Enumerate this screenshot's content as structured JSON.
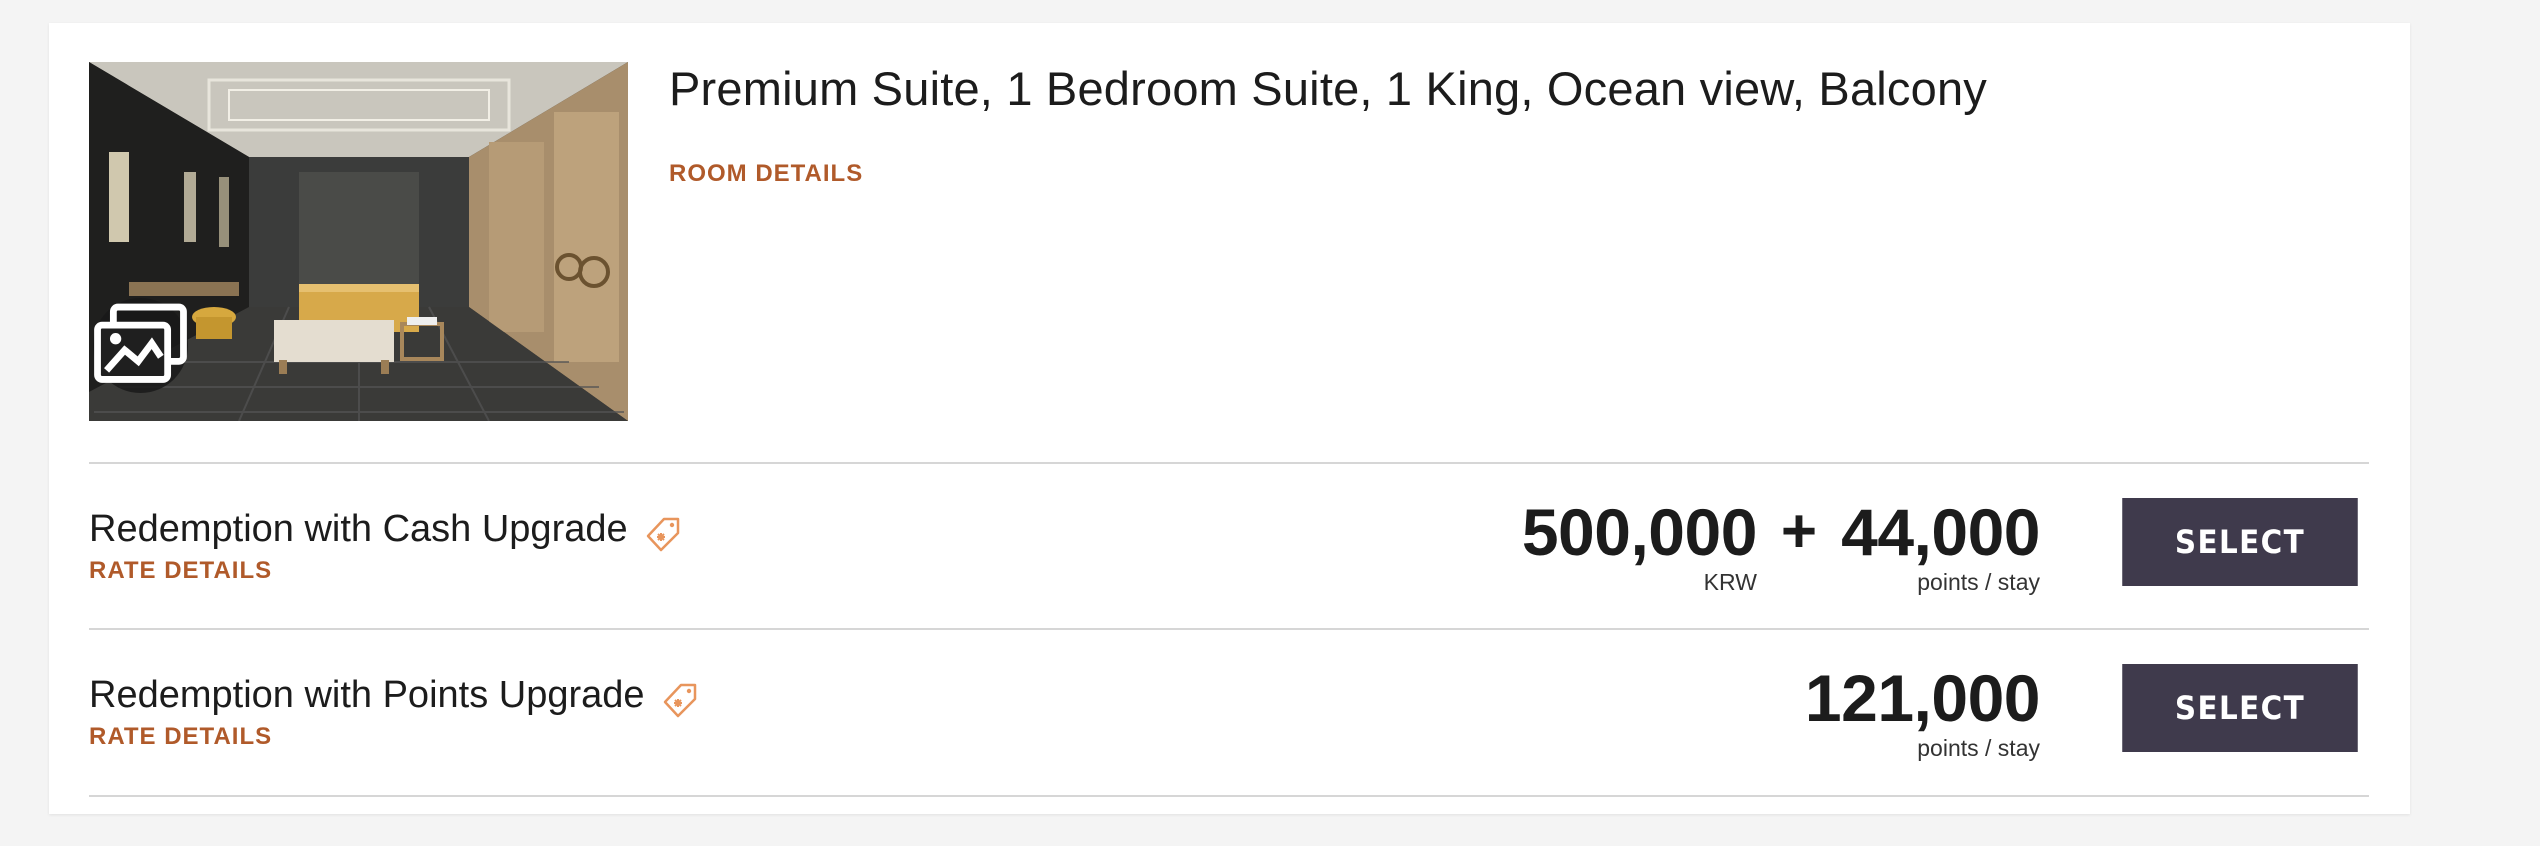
{
  "room": {
    "title": "Premium Suite, 1 Bedroom Suite, 1 King, Ocean view, Balcony",
    "details_link": "ROOM DETAILS",
    "image_icon": "gallery-icon"
  },
  "rates": [
    {
      "name": "Redemption with Cash Upgrade",
      "details_link": "RATE DETAILS",
      "icon": "price-tag-icon",
      "cash_amount": "500,000",
      "cash_unit": "KRW",
      "plus": "+",
      "points_amount": "44,000",
      "points_unit": "points / stay",
      "select_label": "SELECT"
    },
    {
      "name": "Redemption with Points Upgrade",
      "details_link": "RATE DETAILS",
      "icon": "price-tag-icon",
      "points_amount": "121,000",
      "points_unit": "points / stay",
      "select_label": "SELECT"
    }
  ],
  "colors": {
    "accent": "#b05a2a",
    "button": "#3f3a4c",
    "tag_icon": "#e8955c"
  }
}
